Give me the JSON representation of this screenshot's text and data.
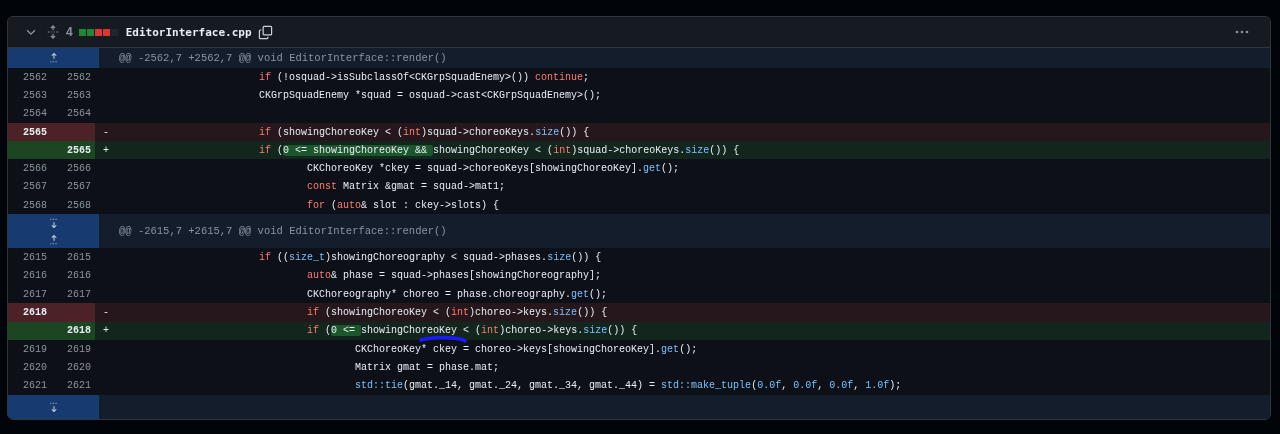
{
  "file": {
    "expanded": true,
    "change_count": "4",
    "diffstat": [
      {
        "kind": "added"
      },
      {
        "kind": "added"
      },
      {
        "kind": "deleted"
      },
      {
        "kind": "deleted"
      },
      {
        "kind": "neutral"
      }
    ],
    "name": "EditorInterface.cpp"
  },
  "hunks": [
    {
      "expanders": [
        {
          "kind": "up"
        }
      ],
      "header": "@@ -2562,7 +2562,7 @@ void EditorInterface::render()",
      "lines": [
        {
          "kind": "context",
          "old": "2562",
          "new": "2562",
          "tokens": [
            {
              "t": "\t\t\tif",
              "kind": "kw"
            },
            {
              "t": " (!osquad->isSubclassOf<CKGrpSquadEnemy>()) ",
              "kind": "plain"
            },
            {
              "t": "continue",
              "kind": "kw"
            },
            {
              "t": ";",
              "kind": "plain"
            }
          ]
        },
        {
          "kind": "context",
          "old": "2563",
          "new": "2563",
          "tokens": [
            {
              "t": "\t\t\tCKGrpSquadEnemy *squad = osquad->cast<CKGrpSquadEnemy>();",
              "kind": "plain"
            }
          ]
        },
        {
          "kind": "context",
          "old": "2564",
          "new": "2564"
        },
        {
          "kind": "deleted",
          "old": "2565",
          "sign": "-",
          "tokens": [
            {
              "t": "\t\t\tif",
              "kind": "kw"
            },
            {
              "t": " (showingChoreoKey < (",
              "kind": "plain"
            },
            {
              "t": "int",
              "kind": "kw"
            },
            {
              "t": ")squad->choreoKeys.",
              "kind": "plain"
            },
            {
              "t": "size",
              "kind": "fn"
            },
            {
              "t": "()) {",
              "kind": "plain"
            }
          ]
        },
        {
          "kind": "added",
          "new": "2565",
          "sign": "+",
          "tokens": [
            {
              "t": "\t\t\tif",
              "kind": "kw"
            },
            {
              "t": " (",
              "kind": "plain"
            },
            {
              "t": "0 <= showingChoreoKey && ",
              "kind": "change"
            },
            {
              "t": "showingChoreoKey < (",
              "kind": "plain"
            },
            {
              "t": "int",
              "kind": "kw"
            },
            {
              "t": ")squad->choreoKeys.",
              "kind": "plain"
            },
            {
              "t": "size",
              "kind": "fn"
            },
            {
              "t": "()) {",
              "kind": "plain"
            }
          ]
        },
        {
          "kind": "context",
          "old": "2566",
          "new": "2566",
          "tokens": [
            {
              "t": "\t\t\t\tCKChoreoKey *ckey = squad->choreoKeys[showingChoreoKey].",
              "kind": "plain"
            },
            {
              "t": "get",
              "kind": "fn"
            },
            {
              "t": "();",
              "kind": "plain"
            }
          ]
        },
        {
          "kind": "context",
          "old": "2567",
          "new": "2567",
          "tokens": [
            {
              "t": "\t\t\t\tconst",
              "kind": "kw"
            },
            {
              "t": " Matrix &gmat = squad->mat1;",
              "kind": "plain"
            }
          ]
        },
        {
          "kind": "context",
          "old": "2568",
          "new": "2568",
          "tokens": [
            {
              "t": "\t\t\t\tfor",
              "kind": "kw"
            },
            {
              "t": " (",
              "kind": "plain"
            },
            {
              "t": "auto",
              "kind": "kw"
            },
            {
              "t": "& slot : ckey->slots) {",
              "kind": "plain"
            }
          ]
        }
      ]
    },
    {
      "expanders": [
        {
          "kind": "down"
        },
        {
          "kind": "up"
        }
      ],
      "header": "@@ -2615,7 +2615,7 @@ void EditorInterface::render()",
      "lines": [
        {
          "kind": "context",
          "old": "2615",
          "new": "2615",
          "tokens": [
            {
              "t": "\t\t\tif",
              "kind": "kw"
            },
            {
              "t": " ((",
              "kind": "plain"
            },
            {
              "t": "size_t",
              "kind": "fn"
            },
            {
              "t": ")showingChoreography < squad->phases.",
              "kind": "plain"
            },
            {
              "t": "size",
              "kind": "fn"
            },
            {
              "t": "()) {",
              "kind": "plain"
            }
          ]
        },
        {
          "kind": "context",
          "old": "2616",
          "new": "2616",
          "tokens": [
            {
              "t": "\t\t\t\tauto",
              "kind": "kw"
            },
            {
              "t": "& phase = squad->phases[showingChoreography];",
              "kind": "plain"
            }
          ]
        },
        {
          "kind": "context",
          "old": "2617",
          "new": "2617",
          "tokens": [
            {
              "t": "\t\t\t\tCKChoreography* choreo = phase.choreography.",
              "kind": "plain"
            },
            {
              "t": "get",
              "kind": "fn"
            },
            {
              "t": "();",
              "kind": "plain"
            }
          ]
        },
        {
          "kind": "deleted",
          "old": "2618",
          "sign": "-",
          "tokens": [
            {
              "t": "\t\t\t\tif",
              "kind": "kw"
            },
            {
              "t": " (showingChoreoKey < (",
              "kind": "plain"
            },
            {
              "t": "int",
              "kind": "kw"
            },
            {
              "t": ")choreo->keys.",
              "kind": "plain"
            },
            {
              "t": "size",
              "kind": "fn"
            },
            {
              "t": "()) {",
              "kind": "plain"
            }
          ]
        },
        {
          "kind": "added",
          "new": "2618",
          "sign": "+",
          "annotation": {
            "kind": "scribble"
          },
          "tokens": [
            {
              "t": "\t\t\t\tif",
              "kind": "kw"
            },
            {
              "t": " (",
              "kind": "plain"
            },
            {
              "t": "0 <= ",
              "kind": "change"
            },
            {
              "t": "showingChoreoKey < (",
              "kind": "plain"
            },
            {
              "t": "int",
              "kind": "kw"
            },
            {
              "t": ")choreo->keys.",
              "kind": "plain"
            },
            {
              "t": "size",
              "kind": "fn"
            },
            {
              "t": "()) {",
              "kind": "plain"
            }
          ]
        },
        {
          "kind": "context",
          "old": "2619",
          "new": "2619",
          "tokens": [
            {
              "t": "\t\t\t\t\tCKChoreoKey* ckey = choreo->keys[showingChoreoKey].",
              "kind": "plain"
            },
            {
              "t": "get",
              "kind": "fn"
            },
            {
              "t": "();",
              "kind": "plain"
            }
          ]
        },
        {
          "kind": "context",
          "old": "2620",
          "new": "2620",
          "tokens": [
            {
              "t": "\t\t\t\t\tMatrix gmat = phase.mat;",
              "kind": "plain"
            }
          ]
        },
        {
          "kind": "context",
          "old": "2621",
          "new": "2621",
          "tokens": [
            {
              "t": "\t\t\t\t\tstd::tie",
              "kind": "fn"
            },
            {
              "t": "(gmat._14, gmat._24, gmat._34, gmat._44) = ",
              "kind": "plain"
            },
            {
              "t": "std::make_tuple",
              "kind": "fn"
            },
            {
              "t": "(",
              "kind": "plain"
            },
            {
              "t": "0.0f",
              "kind": "num"
            },
            {
              "t": ", ",
              "kind": "plain"
            },
            {
              "t": "0.0f",
              "kind": "num"
            },
            {
              "t": ", ",
              "kind": "plain"
            },
            {
              "t": "0.0f",
              "kind": "num"
            },
            {
              "t": ", ",
              "kind": "plain"
            },
            {
              "t": "1.0f",
              "kind": "num"
            },
            {
              "t": ");",
              "kind": "plain"
            }
          ]
        }
      ]
    }
  ],
  "footer_expanders": [
    {
      "kind": "down"
    }
  ]
}
